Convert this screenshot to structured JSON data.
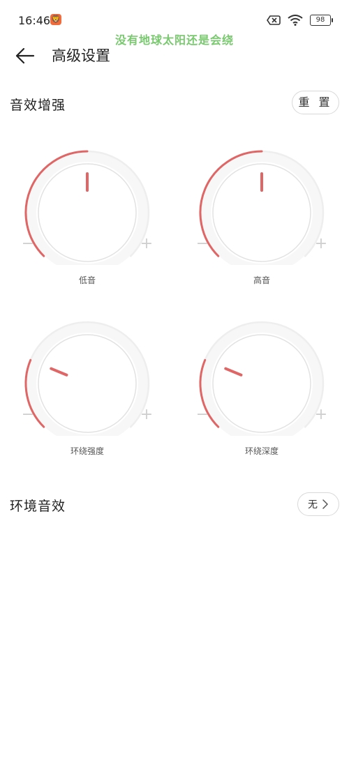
{
  "status": {
    "time": "16:46",
    "app_icon_glyph": "🦁",
    "battery": "98",
    "icons": [
      "sim-error-icon",
      "wifi-icon",
      "battery-icon"
    ]
  },
  "overlay_text": "没有地球太阳还是会绕",
  "header": {
    "title": "高级设置"
  },
  "sound_enhance": {
    "title": "音效增强",
    "reset_label": "重 置",
    "knobs": [
      {
        "label": "低音",
        "minus": "−",
        "plus": "+",
        "level": 0.5
      },
      {
        "label": "高音",
        "minus": "−",
        "plus": "+",
        "level": 0.5
      },
      {
        "label": "环绕强度",
        "minus": "−",
        "plus": "+",
        "level": 0.25
      },
      {
        "label": "环绕深度",
        "minus": "−",
        "plus": "+",
        "level": 0.25
      }
    ]
  },
  "ambient": {
    "title": "环境音效",
    "value": "无"
  },
  "colors": {
    "accent": "#e06666",
    "track": "#eeeeee",
    "overlay": "#79c96f"
  }
}
